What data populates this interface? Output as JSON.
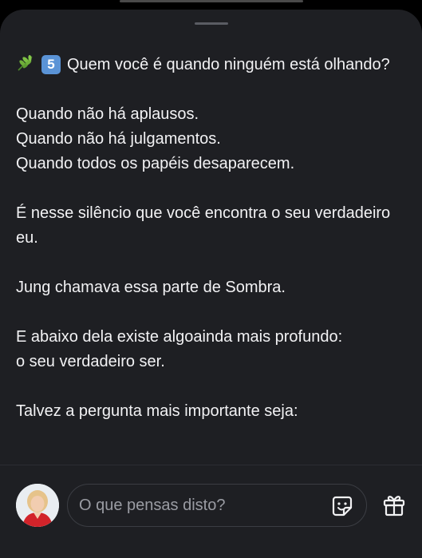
{
  "post": {
    "title_icon_leaf": "herb-icon",
    "title_badge": "5",
    "title_text": "Quem você é quando ninguém está olhando?",
    "paragraphs": [
      [
        "Quando não há aplausos.",
        "Quando não há julgamentos.",
        "Quando todos os papéis desaparecem."
      ],
      [
        "É nesse silêncio que você encontra o seu verdadeiro eu."
      ],
      [
        "Jung chamava essa parte de Sombra."
      ],
      [
        "E abaixo dela existe algoainda mais profundo:",
        "o seu verdadeiro ser."
      ],
      [
        "Talvez a pergunta mais importante seja:"
      ]
    ]
  },
  "composer": {
    "placeholder": "O que pensas disto?",
    "avatar_icon": "user-avatar",
    "sticker_icon": "sticker-icon",
    "gift_icon": "gift-icon"
  },
  "colors": {
    "background": "#1e1f23",
    "text": "#f2f2f4",
    "placeholder": "#9a9ca3",
    "badge": "#5a93d6"
  }
}
